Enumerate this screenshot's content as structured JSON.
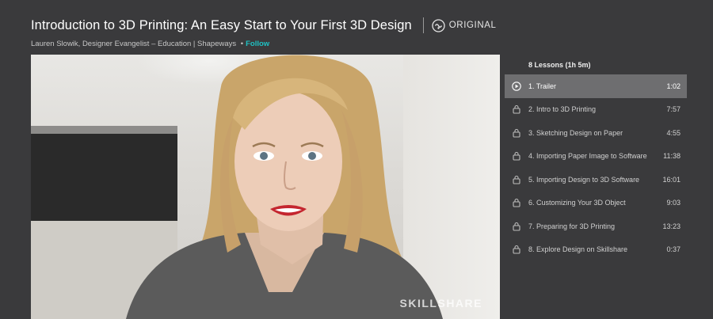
{
  "course": {
    "title": "Introduction to 3D Printing: An Easy Start to Your First 3D Design",
    "badge": "ORIGINAL",
    "teacher": "Lauren Slowik, Designer Evangelist – Education | Shapeways",
    "separator": "•",
    "follow_label": "Follow"
  },
  "video": {
    "watermark": "SKILLSHARE"
  },
  "sidebar": {
    "lessons_header": "8 Lessons (1h 5m)",
    "lessons": [
      {
        "label": "1. Trailer",
        "duration": "1:02",
        "icon": "play-circle-icon",
        "active": true
      },
      {
        "label": "2. Intro to 3D Printing",
        "duration": "7:57",
        "icon": "lock-icon"
      },
      {
        "label": "3. Sketching Design on Paper",
        "duration": "4:55",
        "icon": "lock-icon"
      },
      {
        "label": "4. Importing Paper Image to Software",
        "duration": "11:38",
        "icon": "lock-icon"
      },
      {
        "label": "5. Importing Design to 3D Software",
        "duration": "16:01",
        "icon": "lock-icon"
      },
      {
        "label": "6. Customizing Your 3D Object",
        "duration": "9:03",
        "icon": "lock-icon"
      },
      {
        "label": "7. Preparing for 3D Printing",
        "duration": "13:23",
        "icon": "lock-icon"
      },
      {
        "label": "8. Explore Design on Skillshare",
        "duration": "0:37",
        "icon": "lock-icon"
      }
    ]
  },
  "colors": {
    "background": "#3a3a3c",
    "accent_follow": "#1fc1c3",
    "active_row": "#6e6e70"
  }
}
